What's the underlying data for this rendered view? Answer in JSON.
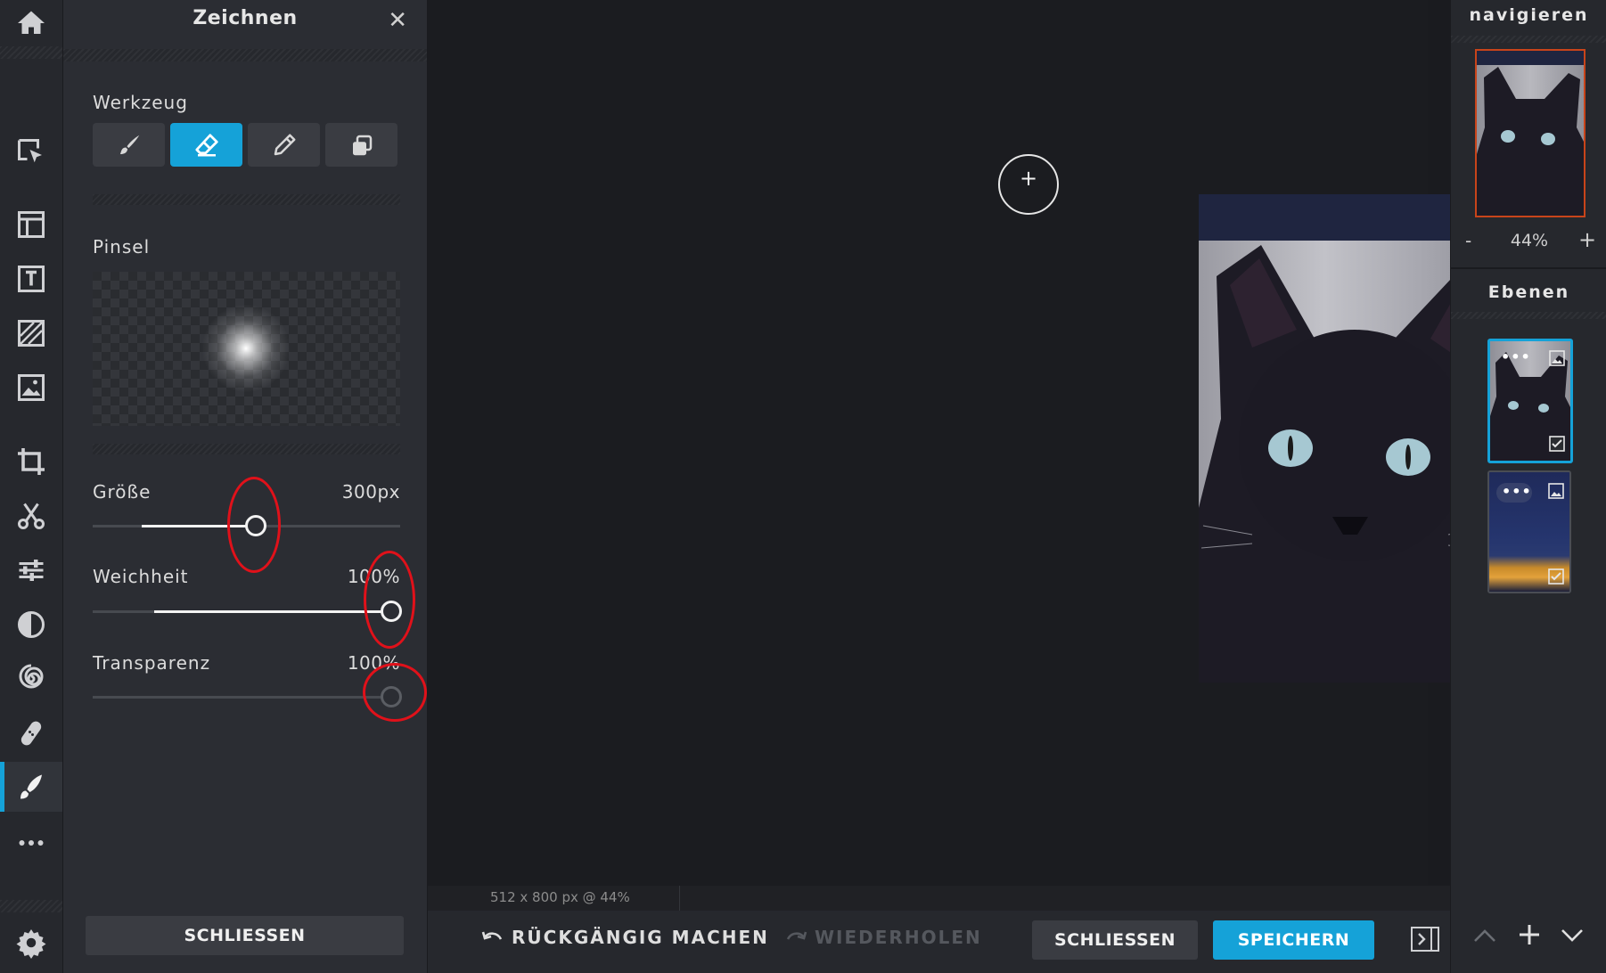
{
  "app": {
    "accent": "#15a2d8",
    "annotation_color": "#e0111a"
  },
  "rail": {
    "items": [
      {
        "name": "home-icon"
      },
      {
        "name": "arrange-icon"
      },
      {
        "name": "layout-icon"
      },
      {
        "name": "text-icon"
      },
      {
        "name": "texture-icon"
      },
      {
        "name": "image-icon"
      },
      {
        "name": "crop-icon"
      },
      {
        "name": "cut-icon"
      },
      {
        "name": "adjust-icon"
      },
      {
        "name": "filter-icon"
      },
      {
        "name": "liquify-icon"
      },
      {
        "name": "retouch-icon"
      },
      {
        "name": "draw-icon",
        "active": true
      },
      {
        "name": "more-icon"
      },
      {
        "name": "settings-icon"
      }
    ]
  },
  "panel": {
    "title": "Zeichnen",
    "close_symbol": "✕",
    "tool_label": "Werkzeug",
    "tools": [
      {
        "name": "brush-icon"
      },
      {
        "name": "eraser-icon",
        "active": true
      },
      {
        "name": "pencil-icon"
      },
      {
        "name": "clone-stamp-icon"
      }
    ],
    "brush_label": "Pinsel",
    "sliders": [
      {
        "label": "Größe",
        "value_text": "300px",
        "fill_from": 0.16,
        "level": 0.53
      },
      {
        "label": "Weichheit",
        "value_text": "100%",
        "fill_from": 0.2,
        "level": 0.97
      },
      {
        "label": "Transparenz",
        "value_text": "100%",
        "fill_from": 0,
        "level": 0.97
      }
    ],
    "close_button": "SCHLIESSEN"
  },
  "canvas": {
    "status": "512 x 800 px @ 44%",
    "cursor_symbol": "+"
  },
  "bottombar": {
    "undo": "RÜCKGÄNGIG MACHEN",
    "redo": "WIEDERHOLEN",
    "close": "SCHLIESSEN",
    "save": "SPEICHERN"
  },
  "rightpanel": {
    "navigate_title": "navigieren",
    "zoom_minus": "-",
    "zoom": "44%",
    "zoom_plus": "+",
    "layers_title": "Ebenen",
    "layers": [
      {
        "name": "cat-layer",
        "selected": true
      },
      {
        "name": "city-layer",
        "selected": false
      }
    ]
  }
}
